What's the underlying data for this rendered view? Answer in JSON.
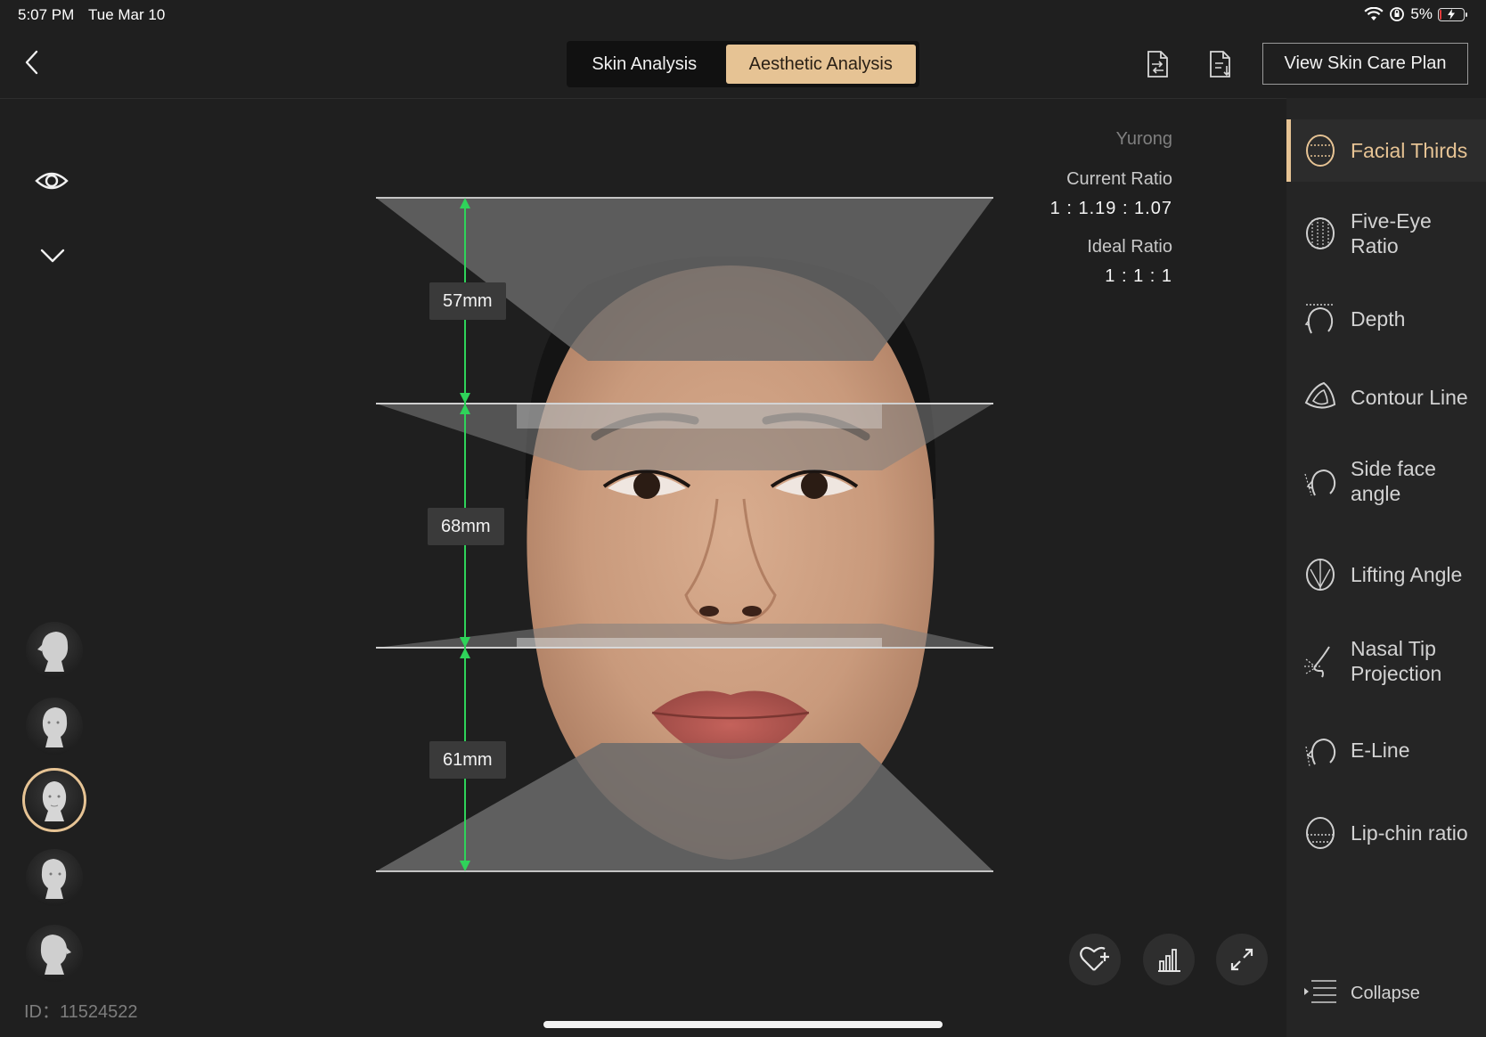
{
  "status_bar": {
    "time": "5:07 PM",
    "date": "Tue Mar 10",
    "battery": "5%",
    "battery_level": 0.05
  },
  "header": {
    "tabs": [
      {
        "label": "Skin Analysis",
        "active": false
      },
      {
        "label": "Aesthetic Analysis",
        "active": true
      }
    ],
    "plan_button": "View Skin Care Plan"
  },
  "ratio": {
    "name": "Yurong",
    "current_label": "Current Ratio",
    "current_value": "1 : 1.19 : 1.07",
    "ideal_label": "Ideal Ratio",
    "ideal_value": "1 : 1 : 1"
  },
  "measurements": [
    {
      "label": "57mm"
    },
    {
      "label": "68mm"
    },
    {
      "label": "61mm"
    }
  ],
  "patient_id": "ID：11524522",
  "sidebar": {
    "items": [
      {
        "label": "Facial Thirds",
        "icon": "facial-thirds-icon",
        "active": true
      },
      {
        "label": "Five-Eye Ratio",
        "icon": "five-eye-icon",
        "active": false
      },
      {
        "label": "Depth",
        "icon": "depth-icon",
        "active": false
      },
      {
        "label": "Contour Line",
        "icon": "contour-line-icon",
        "active": false
      },
      {
        "label": "Side face angle",
        "icon": "side-face-icon",
        "active": false
      },
      {
        "label": "Lifting Angle",
        "icon": "lifting-angle-icon",
        "active": false
      },
      {
        "label": "Nasal Tip Projection",
        "icon": "nasal-tip-icon",
        "active": false
      },
      {
        "label": "E-Line",
        "icon": "e-line-icon",
        "active": false
      },
      {
        "label": "Lip-chin ratio",
        "icon": "lip-chin-icon",
        "active": false
      }
    ],
    "collapse_label": "Collapse"
  },
  "colors": {
    "accent": "#e6c394",
    "measure_line": "#2fd35a",
    "background": "#1f1f1f"
  }
}
